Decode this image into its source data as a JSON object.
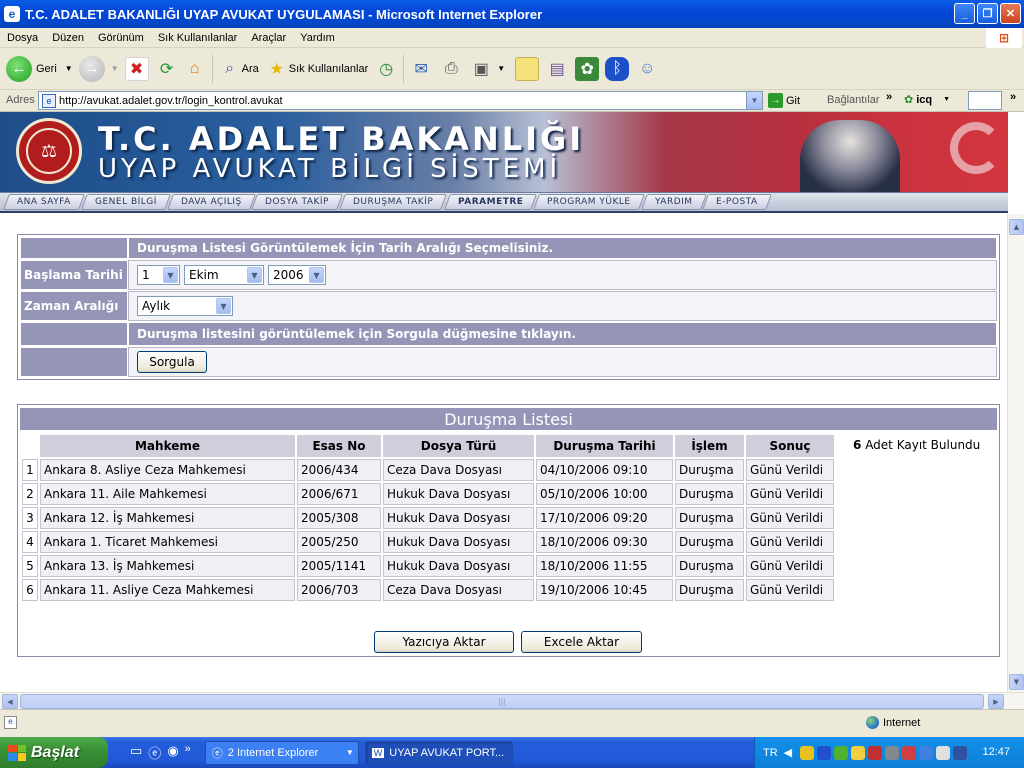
{
  "window": {
    "title": "T.C. ADALET BAKANLIĞI UYAP AVUKAT UYGULAMASI - Microsoft Internet Explorer",
    "min_label": "_",
    "max_label": "❐",
    "close_label": "✕"
  },
  "menu": [
    "Dosya",
    "Düzen",
    "Görünüm",
    "Sık Kullanılanlar",
    "Araçlar",
    "Yardım"
  ],
  "toolbar": {
    "back_label": "Geri",
    "search_label": "Ara",
    "favorites_label": "Sık Kullanılanlar"
  },
  "address": {
    "label": "Adres",
    "url": "http://avukat.adalet.gov.tr/login_kontrol.avukat",
    "go_label": "Git",
    "links_label": "Bağlantılar",
    "icq_label": "icq"
  },
  "banner": {
    "line1": "T.C. ADALET BAKANLIĞI",
    "line2": "UYAP AVUKAT BİLGİ SİSTEMİ",
    "seal_text": "T.C. ADALET BAKANLIĞI"
  },
  "nav": [
    "ANA SAYFA",
    "GENEL BİLGİ",
    "DAVA AÇILIŞ",
    "DOSYA TAKİP",
    "DURUŞMA TAKİP",
    "PARAMETRE",
    "PROGRAM YÜKLE",
    "YARDIM",
    "E-POSTA"
  ],
  "form": {
    "header": "Duruşma Listesi Görüntülemek İçin Tarih Aralığı Seçmelisiniz.",
    "start_label": "Başlama Tarihi",
    "day": "1",
    "month": "Ekim",
    "year": "2006",
    "range_label": "Zaman Aralığı",
    "range_value": "Aylık",
    "hint": "Duruşma listesini görüntülemek için Sorgula düğmesine tıklayın.",
    "query_button": "Sorgula"
  },
  "list": {
    "title": "Duruşma Listesi",
    "columns": [
      "Mahkeme",
      "Esas No",
      "Dosya Türü",
      "Duruşma Tarihi",
      "İşlem",
      "Sonuç"
    ],
    "count": "6",
    "count_suffix": "Adet Kayıt Bulundu",
    "rows": [
      {
        "no": "1",
        "court": "Ankara 8. Asliye Ceza Mahkemesi",
        "case": "2006/434",
        "type": "Ceza Dava Dosyası",
        "date": "04/10/2006 09:10",
        "action": "Duruşma",
        "result": "Günü Verildi"
      },
      {
        "no": "2",
        "court": "Ankara 11. Aile Mahkemesi",
        "case": "2006/671",
        "type": "Hukuk Dava Dosyası",
        "date": "05/10/2006 10:00",
        "action": "Duruşma",
        "result": "Günü Verildi"
      },
      {
        "no": "3",
        "court": "Ankara 12. İş Mahkemesi",
        "case": "2005/308",
        "type": "Hukuk Dava Dosyası",
        "date": "17/10/2006 09:20",
        "action": "Duruşma",
        "result": "Günü Verildi"
      },
      {
        "no": "4",
        "court": "Ankara 1. Ticaret Mahkemesi",
        "case": "2005/250",
        "type": "Hukuk Dava Dosyası",
        "date": "18/10/2006 09:30",
        "action": "Duruşma",
        "result": "Günü Verildi"
      },
      {
        "no": "5",
        "court": "Ankara 13. İş Mahkemesi",
        "case": "2005/1141",
        "type": "Hukuk Dava Dosyası",
        "date": "18/10/2006 11:55",
        "action": "Duruşma",
        "result": "Günü Verildi"
      },
      {
        "no": "6",
        "court": "Ankara 11. Asliye Ceza Mahkemesi",
        "case": "2006/703",
        "type": "Ceza Dava Dosyası",
        "date": "19/10/2006 10:45",
        "action": "Duruşma",
        "result": "Günü Verildi"
      }
    ],
    "print_button": "Yazıcıya Aktar",
    "excel_button": "Excele Aktar"
  },
  "status": {
    "zone": "Internet"
  },
  "taskbar": {
    "start": "Başlat",
    "task1": "2 Internet Explorer",
    "task2": "UYAP AVUKAT PORT...",
    "lang": "TR",
    "clock": "12:47"
  },
  "colors": {
    "header_purple": "#9595b8",
    "title_blue": "#0348c8",
    "start_green": "#3a9135"
  }
}
